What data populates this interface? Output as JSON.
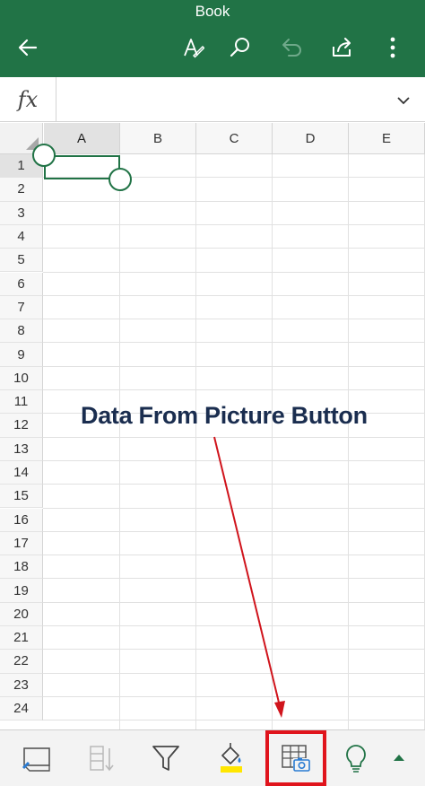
{
  "app": {
    "title": "Book",
    "accent_color": "#217346"
  },
  "appbar": {
    "icons": [
      "back-arrow-icon",
      "draw-pen-icon",
      "search-icon",
      "undo-icon",
      "share-icon",
      "more-vertical-icon"
    ]
  },
  "formula_bar": {
    "fx_label": "fx",
    "value": "",
    "expand_icon": "chevron-down-icon"
  },
  "grid": {
    "columns": [
      "A",
      "B",
      "C",
      "D",
      "E"
    ],
    "rows": [
      "1",
      "2",
      "3",
      "4",
      "5",
      "6",
      "7",
      "8",
      "9",
      "10",
      "11",
      "12",
      "13",
      "14",
      "15",
      "16",
      "17",
      "18",
      "19",
      "20",
      "21",
      "22",
      "23",
      "24"
    ],
    "selected_cell": "A1"
  },
  "annotation": {
    "text": "Data From Picture Button",
    "color": "#1a2d4f",
    "arrow_color": "#d0141c"
  },
  "toolbar": {
    "icons": [
      "view-switch-icon",
      "sort-icon",
      "filter-icon",
      "fill-color-icon",
      "data-from-picture-icon",
      "ideas-lightbulb-icon",
      "expand-up-icon"
    ],
    "fill_color": "#ffe600",
    "highlight_color": "#e0141c"
  }
}
